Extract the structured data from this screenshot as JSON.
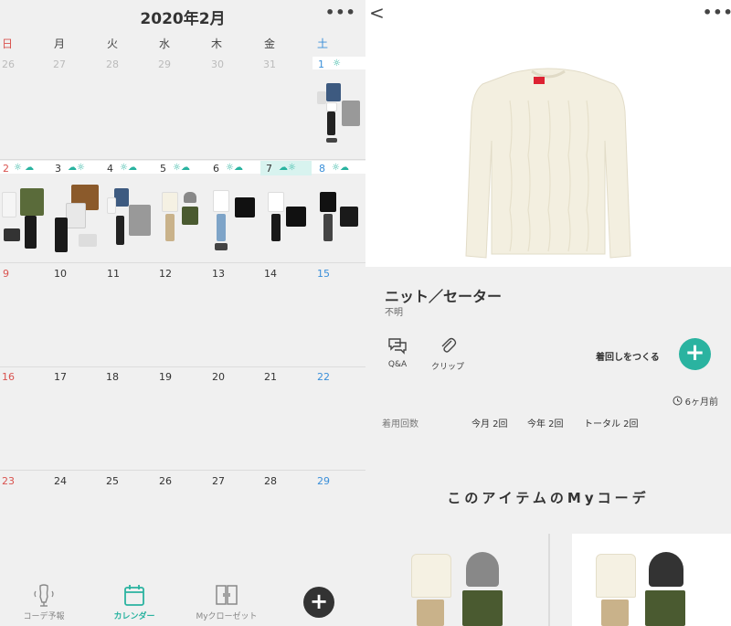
{
  "calendar": {
    "title": "2020年2月",
    "menu_label": "•••",
    "weekdays": [
      "日",
      "月",
      "火",
      "水",
      "木",
      "金",
      "土"
    ],
    "weeks": [
      [
        "26",
        "27",
        "28",
        "29",
        "30",
        "31",
        "1"
      ],
      [
        "2",
        "3",
        "4",
        "5",
        "6",
        "7",
        "8"
      ],
      [
        "9",
        "10",
        "11",
        "12",
        "13",
        "14",
        "15"
      ],
      [
        "16",
        "17",
        "18",
        "19",
        "20",
        "21",
        "22"
      ],
      [
        "23",
        "24",
        "25",
        "26",
        "27",
        "28",
        "29"
      ]
    ],
    "weather": [
      "☼ ☁",
      "☁☼",
      "☼☁",
      "☼☁",
      "☼☁",
      "☁☼",
      "☼☁"
    ],
    "sat_weather": "☼"
  },
  "tabbar": {
    "tabs": [
      {
        "label": "コーデ予報"
      },
      {
        "label": "カレンダー"
      },
      {
        "label": "Myクローゼット"
      }
    ],
    "add_label": "+"
  },
  "item": {
    "back_label": "<",
    "menu_label": "•••",
    "category": "ニット／セーター",
    "brand": "不明",
    "qa_label": "Q&A",
    "clip_label": "クリップ",
    "create_label": "着回しをつくる",
    "plus_label": "+",
    "last_worn": "6ヶ月前",
    "wear_count_label": "着用回数",
    "month_count": "今月 2回",
    "year_count": "今年 2回",
    "total_count": "トータル 2回",
    "my_outfits_title": "このアイテムのMyコーデ"
  },
  "colors": {
    "accent": "#2ab3a0",
    "sunday": "#d9534f",
    "saturday": "#3a8fd9"
  }
}
